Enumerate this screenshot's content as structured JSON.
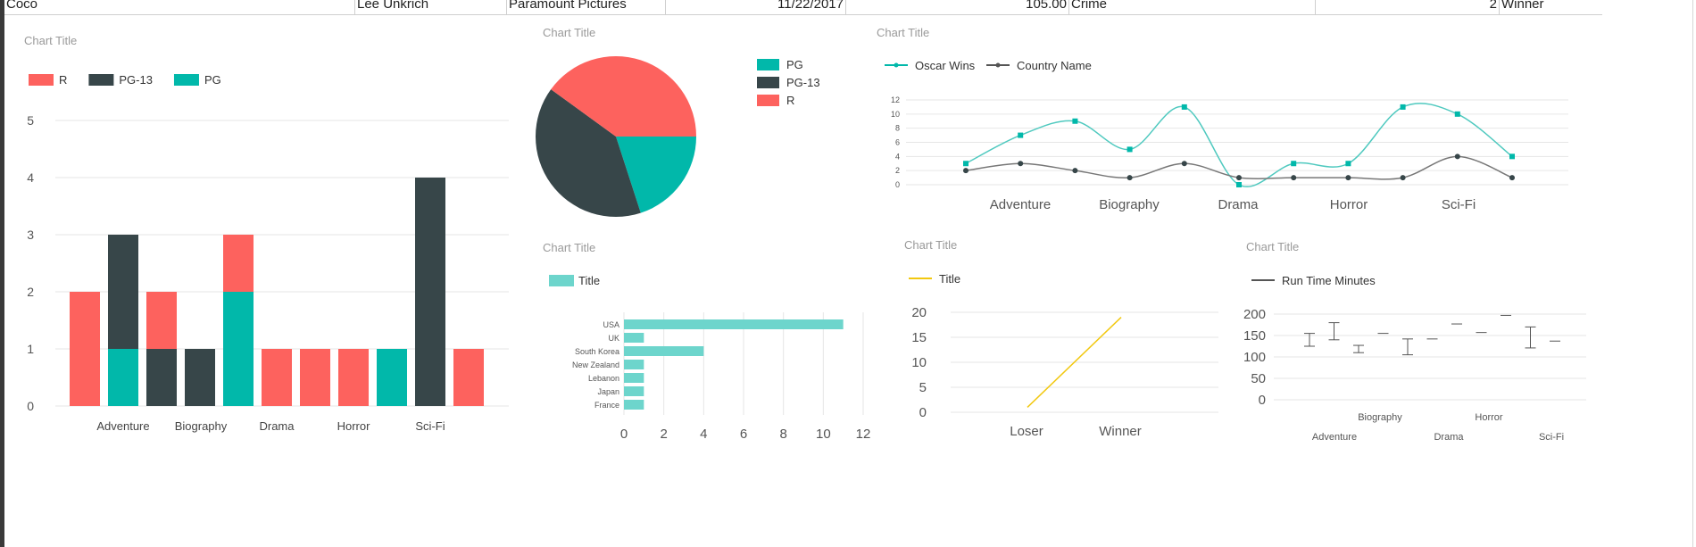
{
  "table_row": [
    "Coco",
    "Lee Unkrich",
    "Paramount Pictures",
    "11/22/2017",
    "105.00",
    "Crime",
    "2",
    "Winner"
  ],
  "colors": {
    "R": "#fd625e",
    "PG13": "#374649",
    "PG": "#01b8aa",
    "bar_light": "#6dd5cc",
    "gold": "#f2c80f",
    "grid": "#e6e6e6"
  },
  "chart_data": [
    {
      "type": "bar",
      "title": "Chart Title",
      "legend": [
        "R",
        "PG-13",
        "PG"
      ],
      "legend_position": "top-left",
      "ylim": [
        0,
        5
      ],
      "yticks": [
        "0",
        "1",
        "2",
        "3",
        "4",
        "5"
      ],
      "category_labels": [
        "Adventure",
        "Biography",
        "Drama",
        "Horror",
        "Sci-Fi"
      ],
      "bars": [
        {
          "R": 2,
          "PG-13": 0,
          "PG": 0
        },
        {
          "R": 0,
          "PG-13": 2,
          "PG": 1
        },
        {
          "R": 1,
          "PG-13": 1,
          "PG": 0
        },
        {
          "R": 0,
          "PG-13": 1,
          "PG": 0
        },
        {
          "R": 1,
          "PG-13": 0,
          "PG": 2
        },
        {
          "R": 1,
          "PG-13": 0,
          "PG": 0
        },
        {
          "R": 1,
          "PG-13": 0,
          "PG": 0
        },
        {
          "R": 1,
          "PG-13": 0,
          "PG": 0
        },
        {
          "R": 0,
          "PG-13": 0,
          "PG": 1
        },
        {
          "R": 0,
          "PG-13": 4,
          "PG": 0
        },
        {
          "R": 1,
          "PG-13": 0,
          "PG": 0
        }
      ]
    },
    {
      "type": "pie",
      "title": "Chart Title",
      "legend": [
        "PG",
        "PG-13",
        "R"
      ],
      "legend_position": "right",
      "slices": [
        {
          "name": "PG",
          "value": 4
        },
        {
          "name": "PG-13",
          "value": 8
        },
        {
          "name": "R",
          "value": 8
        }
      ]
    },
    {
      "type": "line",
      "title": "Chart Title",
      "legend": [
        "Oscar Wins",
        "Country Name"
      ],
      "ylim": [
        0,
        12
      ],
      "yticks": [
        "0",
        "2",
        "4",
        "6",
        "8",
        "10",
        "12"
      ],
      "category_labels": [
        "Adventure",
        "Biography",
        "Drama",
        "Horror",
        "Sci-Fi"
      ],
      "series": [
        {
          "name": "Oscar Wins",
          "values": [
            3,
            7,
            9,
            5,
            11,
            0,
            3,
            3,
            11,
            10,
            4
          ]
        },
        {
          "name": "Country Name",
          "values": [
            2,
            3,
            2,
            1,
            3,
            1,
            1,
            1,
            1,
            4,
            1
          ]
        }
      ]
    },
    {
      "type": "bar",
      "orientation": "horizontal",
      "title": "Chart Title",
      "legend": [
        "Title"
      ],
      "categories": [
        "USA",
        "UK",
        "South Korea",
        "New Zealand",
        "Lebanon",
        "Japan",
        "France"
      ],
      "values": [
        11,
        1,
        4,
        1,
        1,
        1,
        1
      ],
      "xlim": [
        0,
        12
      ],
      "xticks": [
        "0",
        "2",
        "4",
        "6",
        "8",
        "10",
        "12"
      ]
    },
    {
      "type": "line",
      "title": "Chart Title",
      "legend": [
        "Title"
      ],
      "categories": [
        "Loser",
        "Winner"
      ],
      "values": [
        1,
        19
      ],
      "ylim": [
        0,
        20
      ],
      "yticks": [
        "0",
        "5",
        "10",
        "15",
        "20"
      ]
    },
    {
      "type": "line",
      "title": "Chart Title",
      "legend": [
        "Run Time Minutes"
      ],
      "ylim": [
        0,
        200
      ],
      "yticks": [
        "0",
        "50",
        "100",
        "150",
        "200"
      ],
      "category_labels_upper": [
        "Biography",
        "Horror"
      ],
      "category_labels_lower": [
        "Adventure",
        "Drama",
        "Sci-Fi"
      ],
      "ranges": [
        [
          125,
          155
        ],
        [
          140,
          180
        ],
        [
          110,
          127
        ],
        [
          155,
          155
        ],
        [
          105,
          142
        ],
        [
          142,
          142
        ],
        [
          177,
          177
        ],
        [
          157,
          157
        ],
        [
          197,
          197
        ],
        [
          121,
          170
        ],
        [
          137,
          137
        ]
      ]
    }
  ]
}
